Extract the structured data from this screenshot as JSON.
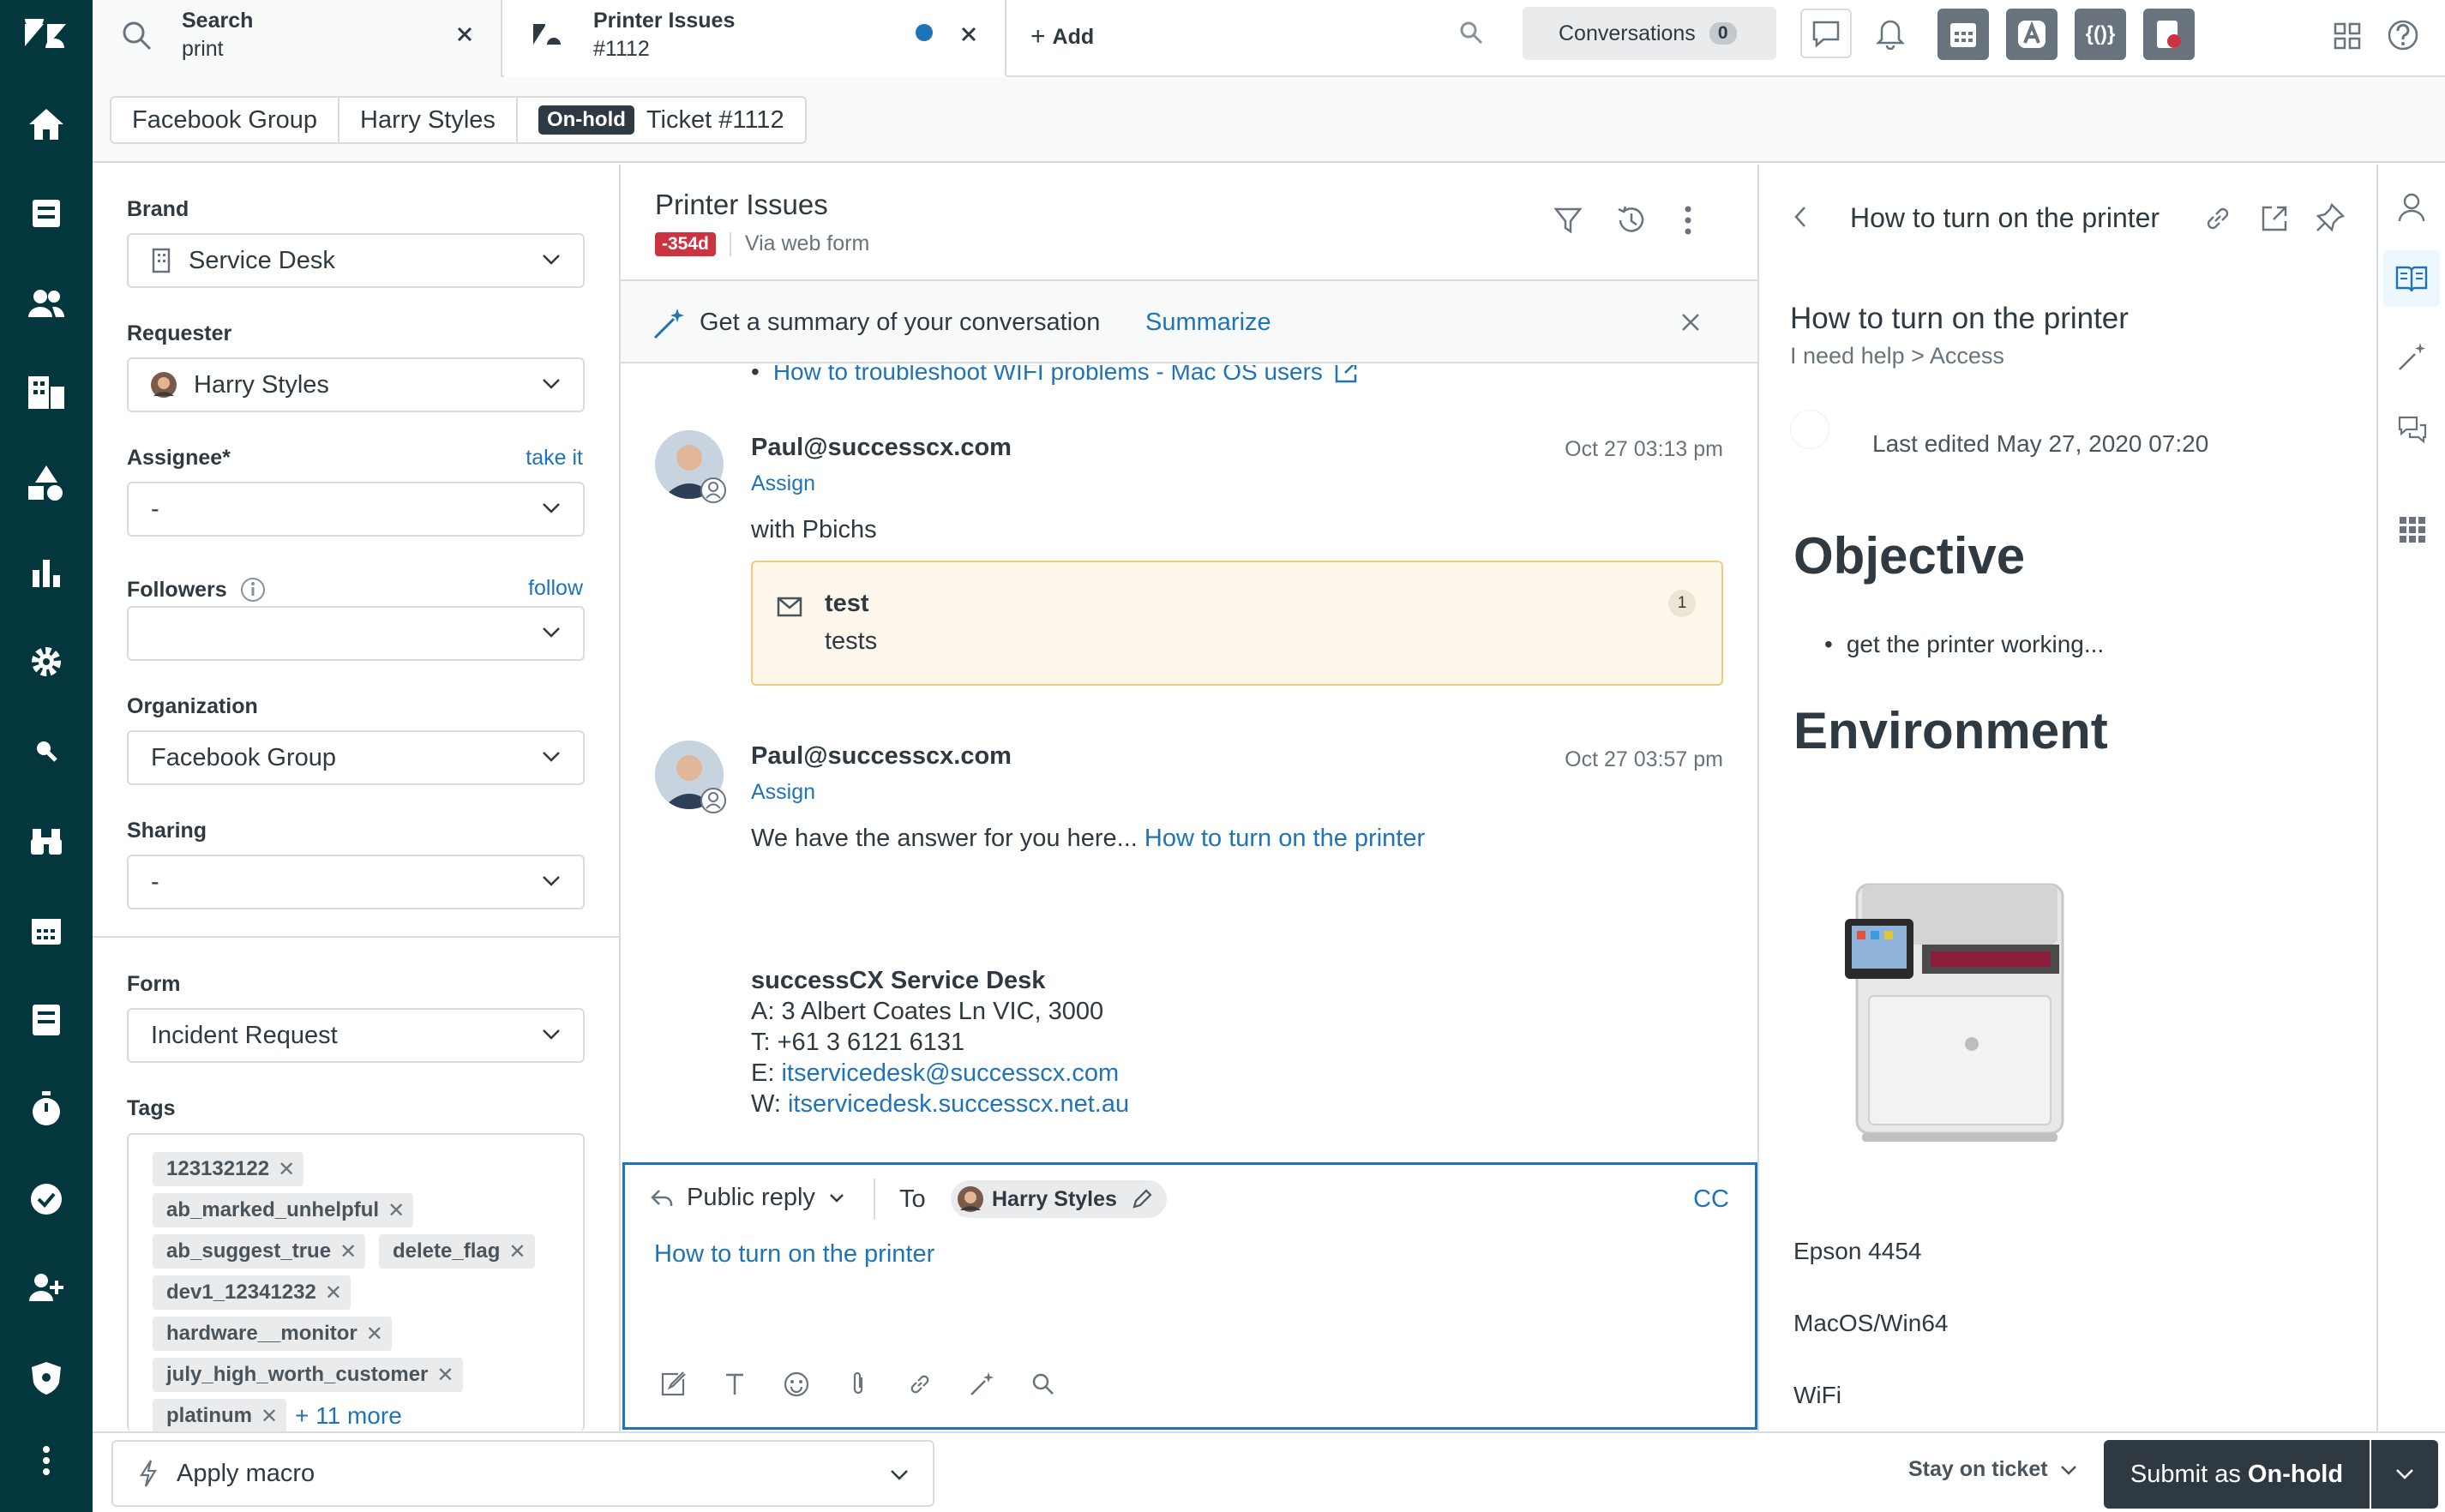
{
  "tabs": [
    {
      "title": "Search",
      "subtitle": "print"
    },
    {
      "title": "Printer Issues",
      "subtitle": "#1112"
    }
  ],
  "add_label": "Add",
  "conversations": {
    "label": "Conversations",
    "count": "0"
  },
  "breadcrumbs": {
    "org": "Facebook Group",
    "user": "Harry Styles",
    "status": "On-hold",
    "ticket": "Ticket #1112"
  },
  "fields": {
    "brand": {
      "label": "Brand",
      "value": "Service Desk"
    },
    "requester": {
      "label": "Requester",
      "value": "Harry Styles"
    },
    "assignee": {
      "label": "Assignee*",
      "value": "-",
      "action": "take it"
    },
    "followers": {
      "label": "Followers",
      "value": "",
      "action": "follow"
    },
    "organization": {
      "label": "Organization",
      "value": "Facebook Group"
    },
    "sharing": {
      "label": "Sharing",
      "value": "-"
    },
    "form": {
      "label": "Form",
      "value": "Incident Request"
    },
    "tags": {
      "label": "Tags",
      "items": [
        "123132122",
        "ab_marked_unhelpful",
        "ab_suggest_true",
        "delete_flag",
        "dev1_12341232",
        "hardware__monitor",
        "july_high_worth_customer",
        "platinum"
      ],
      "more": "+ 11 more"
    }
  },
  "ticket": {
    "title": "Printer Issues",
    "age_badge": "-354d",
    "channel": "Via web form",
    "summary_prompt": "Get a summary of your conversation",
    "summarize": "Summarize",
    "prev_link": "How to troubleshoot WIFI problems - Mac OS users",
    "messages": [
      {
        "author": "Paul@successcx.com",
        "time": "Oct 27 03:13 pm",
        "assign": "Assign",
        "body": "with Pbichs",
        "note_title": "test",
        "note_body": "tests",
        "note_count": "1"
      },
      {
        "author": "Paul@successcx.com",
        "time": "Oct 27 03:57 pm",
        "assign": "Assign",
        "body": "We have the answer for you here...",
        "body_link": "How to turn on the printer"
      }
    ],
    "signature": {
      "name": "successCX Service Desk",
      "address": "A: 3 Albert Coates Ln VIC, 3000",
      "phone": "T: +61 3 6121 6131",
      "email_prefix": "E: ",
      "email": "itservicedesk@successcx.com",
      "web_prefix": "W: ",
      "web": "itservicedesk.successcx.net.au"
    }
  },
  "composer": {
    "mode": "Public reply",
    "to_label": "To",
    "recipient": "Harry Styles",
    "cc": "CC",
    "content": "How to turn on the printer"
  },
  "article": {
    "header": "How to turn on the printer",
    "title": "How to turn on the printer",
    "path": "I need help > Access",
    "edited": "Last edited May 27, 2020 07:20",
    "h1": "Objective",
    "bullet": "get the printer working...",
    "h2": "Environment",
    "env": [
      "Epson 4454",
      "MacOS/Win64",
      "WiFi"
    ]
  },
  "bottom": {
    "macro": "Apply macro",
    "stay": "Stay on ticket",
    "submit_prefix": "Submit as ",
    "submit_status": "On-hold"
  },
  "colors": {
    "nav": "#03363d",
    "link": "#1f73b7",
    "badge_red": "#cc3340",
    "submit": "#2f3941",
    "note_bg": "#fef7ec",
    "note_border": "#f5c97b"
  }
}
